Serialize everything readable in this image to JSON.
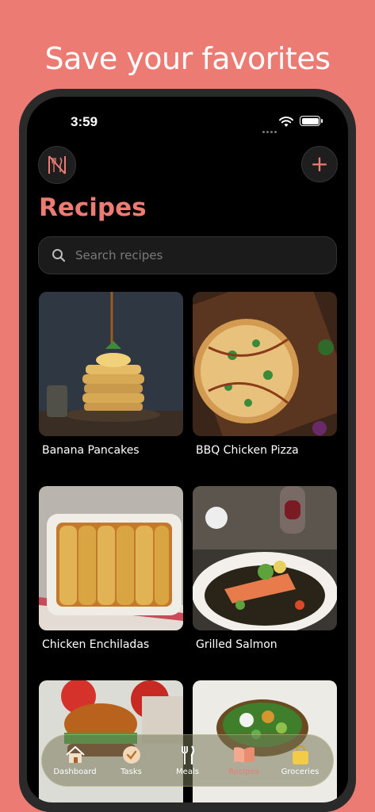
{
  "headline": "Save your favorites",
  "status_bar": {
    "time": "3:59"
  },
  "header": {
    "title": "Recipes",
    "add_label": "+"
  },
  "search": {
    "placeholder": "Search recipes",
    "value": ""
  },
  "recipes": [
    {
      "name": "Banana Pancakes"
    },
    {
      "name": "BBQ Chicken Pizza"
    },
    {
      "name": "Chicken Enchiladas"
    },
    {
      "name": "Grilled Salmon"
    },
    {
      "name": ""
    },
    {
      "name": ""
    }
  ],
  "tabs": [
    {
      "label": "Dashboard",
      "icon": "house-icon",
      "active": false
    },
    {
      "label": "Tasks",
      "icon": "check-circle-icon",
      "active": false
    },
    {
      "label": "Meals",
      "icon": "fork-knife-icon",
      "active": false
    },
    {
      "label": "Recipes",
      "icon": "open-book-icon",
      "active": true
    },
    {
      "label": "Groceries",
      "icon": "shopping-bag-icon",
      "active": false
    }
  ],
  "colors": {
    "accent": "#ec7b74",
    "background": "#000000",
    "page_bg": "#ec7b74"
  }
}
